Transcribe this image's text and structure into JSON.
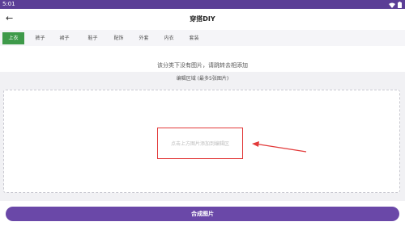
{
  "status_bar": {
    "time": "5:01",
    "icons": [
      "wifi-icon",
      "battery-icon"
    ]
  },
  "app_bar": {
    "back_icon": "arrow-left-icon",
    "title": "穿搭DIY"
  },
  "tabs": [
    {
      "label": "上衣",
      "active": true
    },
    {
      "label": "裤子",
      "active": false
    },
    {
      "label": "裙子",
      "active": false
    },
    {
      "label": "鞋子",
      "active": false
    },
    {
      "label": "配饰",
      "active": false
    },
    {
      "label": "外套",
      "active": false
    },
    {
      "label": "内衣",
      "active": false
    },
    {
      "label": "套装",
      "active": false
    }
  ],
  "empty_hint": "该分类下没有图片，请跳转去相添加",
  "edit_area": {
    "label": "编辑区域 (最多5张图片)",
    "placeholder": "点击上方图片添加到编辑区"
  },
  "merge_button": "合成图片",
  "colors": {
    "status_bar": "#5b3e96",
    "active_tab": "#3e9a4a",
    "primary_button": "#6a48a8",
    "annotation": "#e23a3a"
  }
}
